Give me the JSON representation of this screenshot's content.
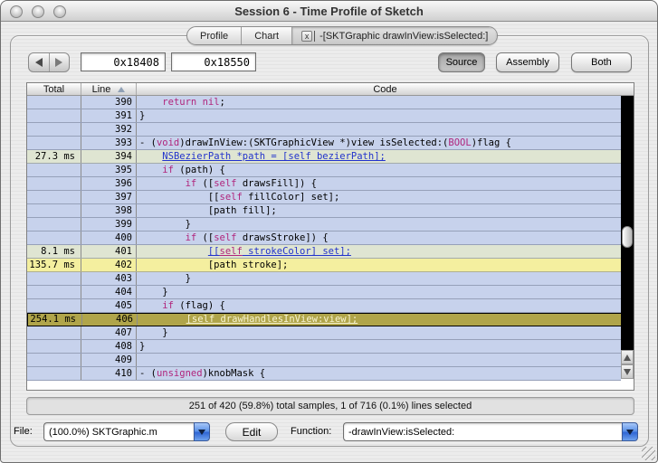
{
  "window": {
    "title": "Session 6 - Time Profile of Sketch"
  },
  "tabs": {
    "profile": "Profile",
    "chart": "Chart",
    "active_label": "-[SKTGraphic drawInView:isSelected:]",
    "close_glyph": "x"
  },
  "toolbar": {
    "address_start": "0x18408",
    "address_end": "0x18550",
    "source": "Source",
    "assembly": "Assembly",
    "both": "Both"
  },
  "table": {
    "header_total": "Total",
    "header_line": "Line",
    "header_code": "Code",
    "rows": [
      {
        "total": "",
        "line": "390",
        "hl": "blue",
        "segs": [
          {
            "c": "p",
            "t": "    "
          },
          {
            "c": "k",
            "t": "return"
          },
          {
            "c": "p",
            "t": " "
          },
          {
            "c": "k",
            "t": "nil"
          },
          {
            "c": "p",
            "t": ";"
          }
        ]
      },
      {
        "total": "",
        "line": "391",
        "hl": "blue",
        "segs": [
          {
            "c": "p",
            "t": "}"
          }
        ]
      },
      {
        "total": "",
        "line": "392",
        "hl": "blue",
        "segs": []
      },
      {
        "total": "",
        "line": "393",
        "hl": "blue",
        "segs": [
          {
            "c": "p",
            "t": "- ("
          },
          {
            "c": "k",
            "t": "void"
          },
          {
            "c": "p",
            "t": ")drawInView:(SKTGraphicView *)view isSelected:("
          },
          {
            "c": "k",
            "t": "BOOL"
          },
          {
            "c": "p",
            "t": ")flag {"
          }
        ]
      },
      {
        "total": "27.3 ms",
        "line": "394",
        "hl": "green",
        "segs": [
          {
            "c": "p",
            "t": "    "
          },
          {
            "c": "b",
            "t": "NSBezierPath *path = [self bezierPath];"
          }
        ]
      },
      {
        "total": "",
        "line": "395",
        "hl": "blue",
        "segs": [
          {
            "c": "p",
            "t": "    "
          },
          {
            "c": "k",
            "t": "if"
          },
          {
            "c": "p",
            "t": " (path) {"
          }
        ]
      },
      {
        "total": "",
        "line": "396",
        "hl": "blue",
        "segs": [
          {
            "c": "p",
            "t": "        "
          },
          {
            "c": "k",
            "t": "if"
          },
          {
            "c": "p",
            "t": " (["
          },
          {
            "c": "k",
            "t": "self"
          },
          {
            "c": "p",
            "t": " drawsFill]) {"
          }
        ]
      },
      {
        "total": "",
        "line": "397",
        "hl": "blue",
        "segs": [
          {
            "c": "p",
            "t": "            [["
          },
          {
            "c": "k",
            "t": "self"
          },
          {
            "c": "p",
            "t": " fillColor] set];"
          }
        ]
      },
      {
        "total": "",
        "line": "398",
        "hl": "blue",
        "segs": [
          {
            "c": "p",
            "t": "            [path fill];"
          }
        ]
      },
      {
        "total": "",
        "line": "399",
        "hl": "blue",
        "segs": [
          {
            "c": "p",
            "t": "        }"
          }
        ]
      },
      {
        "total": "",
        "line": "400",
        "hl": "blue",
        "segs": [
          {
            "c": "p",
            "t": "        "
          },
          {
            "c": "k",
            "t": "if"
          },
          {
            "c": "p",
            "t": " (["
          },
          {
            "c": "k",
            "t": "self"
          },
          {
            "c": "p",
            "t": " drawsStroke]) {"
          }
        ]
      },
      {
        "total": "8.1 ms",
        "line": "401",
        "hl": "green",
        "segs": [
          {
            "c": "p",
            "t": "            "
          },
          {
            "c": "b",
            "t": "[["
          },
          {
            "c": "kb",
            "t": "self"
          },
          {
            "c": "b",
            "t": " strokeColor] set];"
          }
        ]
      },
      {
        "total": "135.7 ms",
        "line": "402",
        "hl": "yellow",
        "segs": [
          {
            "c": "p",
            "t": "            [path stroke];"
          }
        ]
      },
      {
        "total": "",
        "line": "403",
        "hl": "blue",
        "segs": [
          {
            "c": "p",
            "t": "        }"
          }
        ]
      },
      {
        "total": "",
        "line": "404",
        "hl": "blue",
        "segs": [
          {
            "c": "p",
            "t": "    }"
          }
        ]
      },
      {
        "total": "",
        "line": "405",
        "hl": "blue",
        "segs": [
          {
            "c": "p",
            "t": "    "
          },
          {
            "c": "k",
            "t": "if"
          },
          {
            "c": "p",
            "t": " (flag) {"
          }
        ]
      },
      {
        "total": "254.1 ms",
        "line": "406",
        "hl": "sel",
        "segs": [
          {
            "c": "p",
            "t": "        "
          },
          {
            "c": "w",
            "t": "[self drawHandlesInView:view];"
          }
        ]
      },
      {
        "total": "",
        "line": "407",
        "hl": "blue",
        "segs": [
          {
            "c": "p",
            "t": "    }"
          }
        ]
      },
      {
        "total": "",
        "line": "408",
        "hl": "blue",
        "segs": [
          {
            "c": "p",
            "t": "}"
          }
        ]
      },
      {
        "total": "",
        "line": "409",
        "hl": "blue",
        "segs": []
      },
      {
        "total": "",
        "line": "410",
        "hl": "blue",
        "segs": [
          {
            "c": "p",
            "t": "- ("
          },
          {
            "c": "k",
            "t": "unsigned"
          },
          {
            "c": "p",
            "t": ")knobMask {"
          }
        ]
      }
    ]
  },
  "status": {
    "text": "251 of 420 (59.8%) total samples, 1 of 716 (0.1%) lines selected"
  },
  "footer": {
    "file_label": "File:",
    "file_value": "(100.0%) SKTGraphic.m",
    "edit": "Edit",
    "function_label": "Function:",
    "function_value": "-drawInView:isSelected:"
  },
  "colors": {
    "row_blue": "#c7d2ec",
    "row_green": "#dfe5d2",
    "row_yellow": "#f4ef9f",
    "row_selected": "#b0a54a",
    "keyword": "#b0257c",
    "link": "#2233cc",
    "selected_link_text": "#f8f4d0"
  }
}
